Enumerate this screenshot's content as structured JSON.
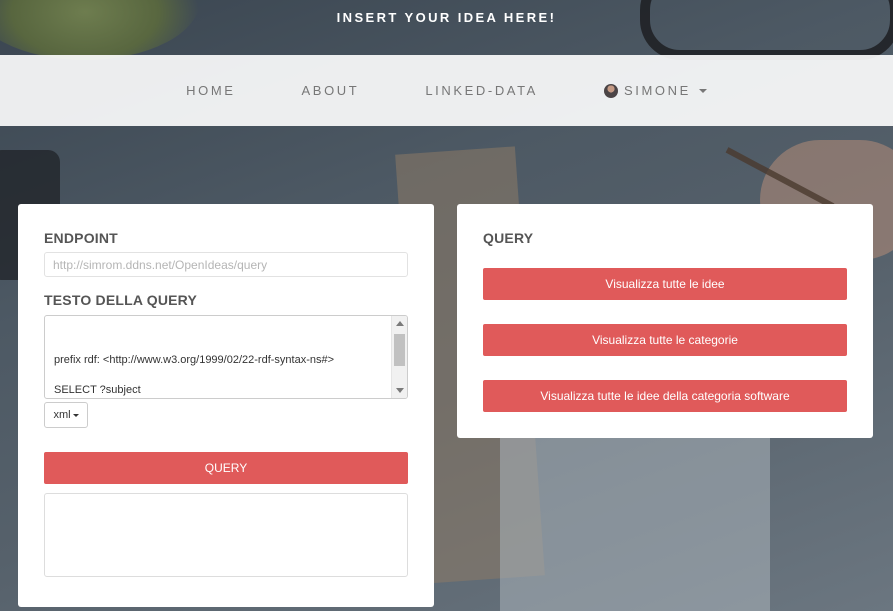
{
  "header": {
    "tagline": "INSERT YOUR IDEA HERE!"
  },
  "nav": {
    "items": [
      "HOME",
      "ABOUT",
      "LINKED-DATA"
    ],
    "user": "SIMONE"
  },
  "query_panel": {
    "endpoint_label": "ENDPOINT",
    "endpoint_placeholder": "http://simrom.ddns.net/OpenIdeas/query",
    "query_label": "TESTO DELLA QUERY",
    "query_text": "prefix rdf: <http://www.w3.org/1999/02/22-rdf-syntax-ns#>\n\nSELECT ?subject\nWHERE {\n      ?subject rdf:type",
    "format_selected": "xml",
    "submit_label": "QUERY"
  },
  "presets_panel": {
    "title": "QUERY",
    "buttons": [
      "Visualizza tutte le idee",
      "Visualizza tutte le categorie",
      "Visualizza tutte le idee della categoria software"
    ]
  },
  "colors": {
    "accent": "#e05a5a",
    "navbar": "#ffffff",
    "text_muted": "#777777"
  }
}
